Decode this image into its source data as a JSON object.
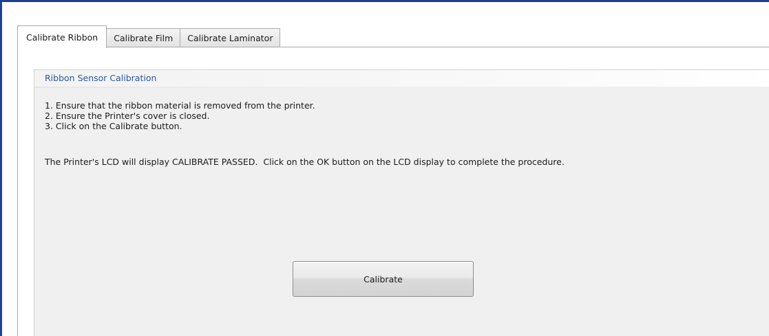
{
  "tabs": [
    {
      "label": "Calibrate Ribbon",
      "active": true
    },
    {
      "label": "Calibrate Film",
      "active": false
    },
    {
      "label": "Calibrate Laminator",
      "active": false
    }
  ],
  "group": {
    "title": "Ribbon Sensor Calibration",
    "steps": [
      "1. Ensure that the ribbon material is removed from the printer.",
      "2. Ensure the Printer's cover is closed.",
      "3. Click on the Calibrate button."
    ],
    "note": "The Printer's LCD will display CALIBRATE PASSED.  Click on the OK button on the LCD display to complete the procedure."
  },
  "button": {
    "label": "Calibrate"
  },
  "colors": {
    "window_border": "#1f3f8f",
    "group_title": "#2b5797",
    "panel_background": "#f0f0f0"
  }
}
